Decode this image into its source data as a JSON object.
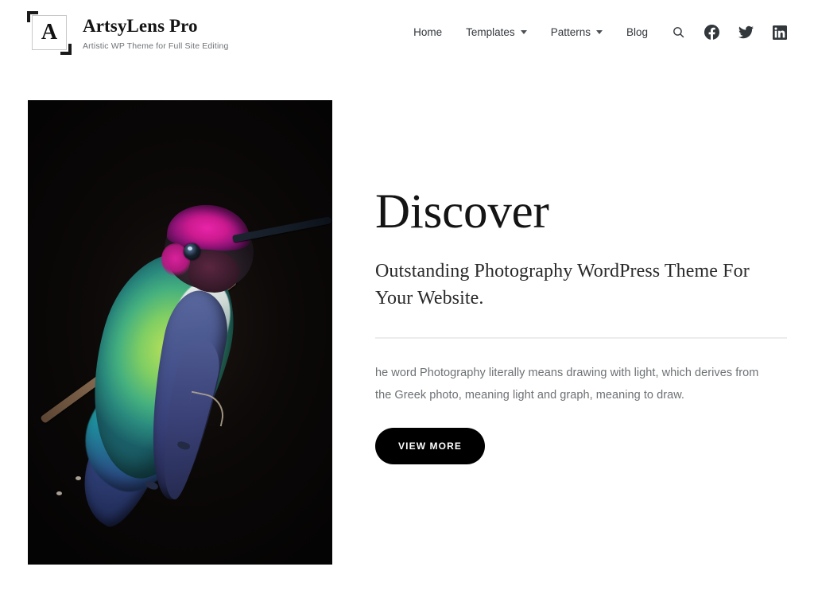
{
  "header": {
    "logo": {
      "letter": "A",
      "icon_name": "framed-letter-a-logo"
    },
    "site_title": "ArtsyLens Pro",
    "tagline": "Artistic WP Theme for Full Site Editing",
    "nav": [
      {
        "label": "Home",
        "has_dropdown": false
      },
      {
        "label": "Templates",
        "has_dropdown": true
      },
      {
        "label": "Patterns",
        "has_dropdown": true
      },
      {
        "label": "Blog",
        "has_dropdown": false
      }
    ],
    "icons": [
      {
        "name": "search-icon",
        "label": "Search"
      },
      {
        "name": "facebook-icon",
        "label": "Facebook"
      },
      {
        "name": "twitter-icon",
        "label": "Twitter"
      },
      {
        "name": "linkedin-icon",
        "label": "LinkedIn"
      }
    ]
  },
  "hero": {
    "image": {
      "name": "hummingbird-photo",
      "alt": "Anna's hummingbird with magenta crown and iridescent green body perched on a twig against a black background"
    },
    "title": "Discover",
    "subtitle": "Outstanding Photography WordPress Theme For Your Website.",
    "body": "he word Photography literally means drawing with light, which derives from the Greek photo, meaning light and graph, meaning to draw.",
    "cta_label": "VIEW MORE"
  },
  "colors": {
    "text_dark": "#141414",
    "text_muted": "#6d7174",
    "nav_text": "#32373c",
    "button_bg": "#000000",
    "button_text": "#ffffff",
    "divider": "#ececec",
    "page_bg": "#ffffff"
  }
}
